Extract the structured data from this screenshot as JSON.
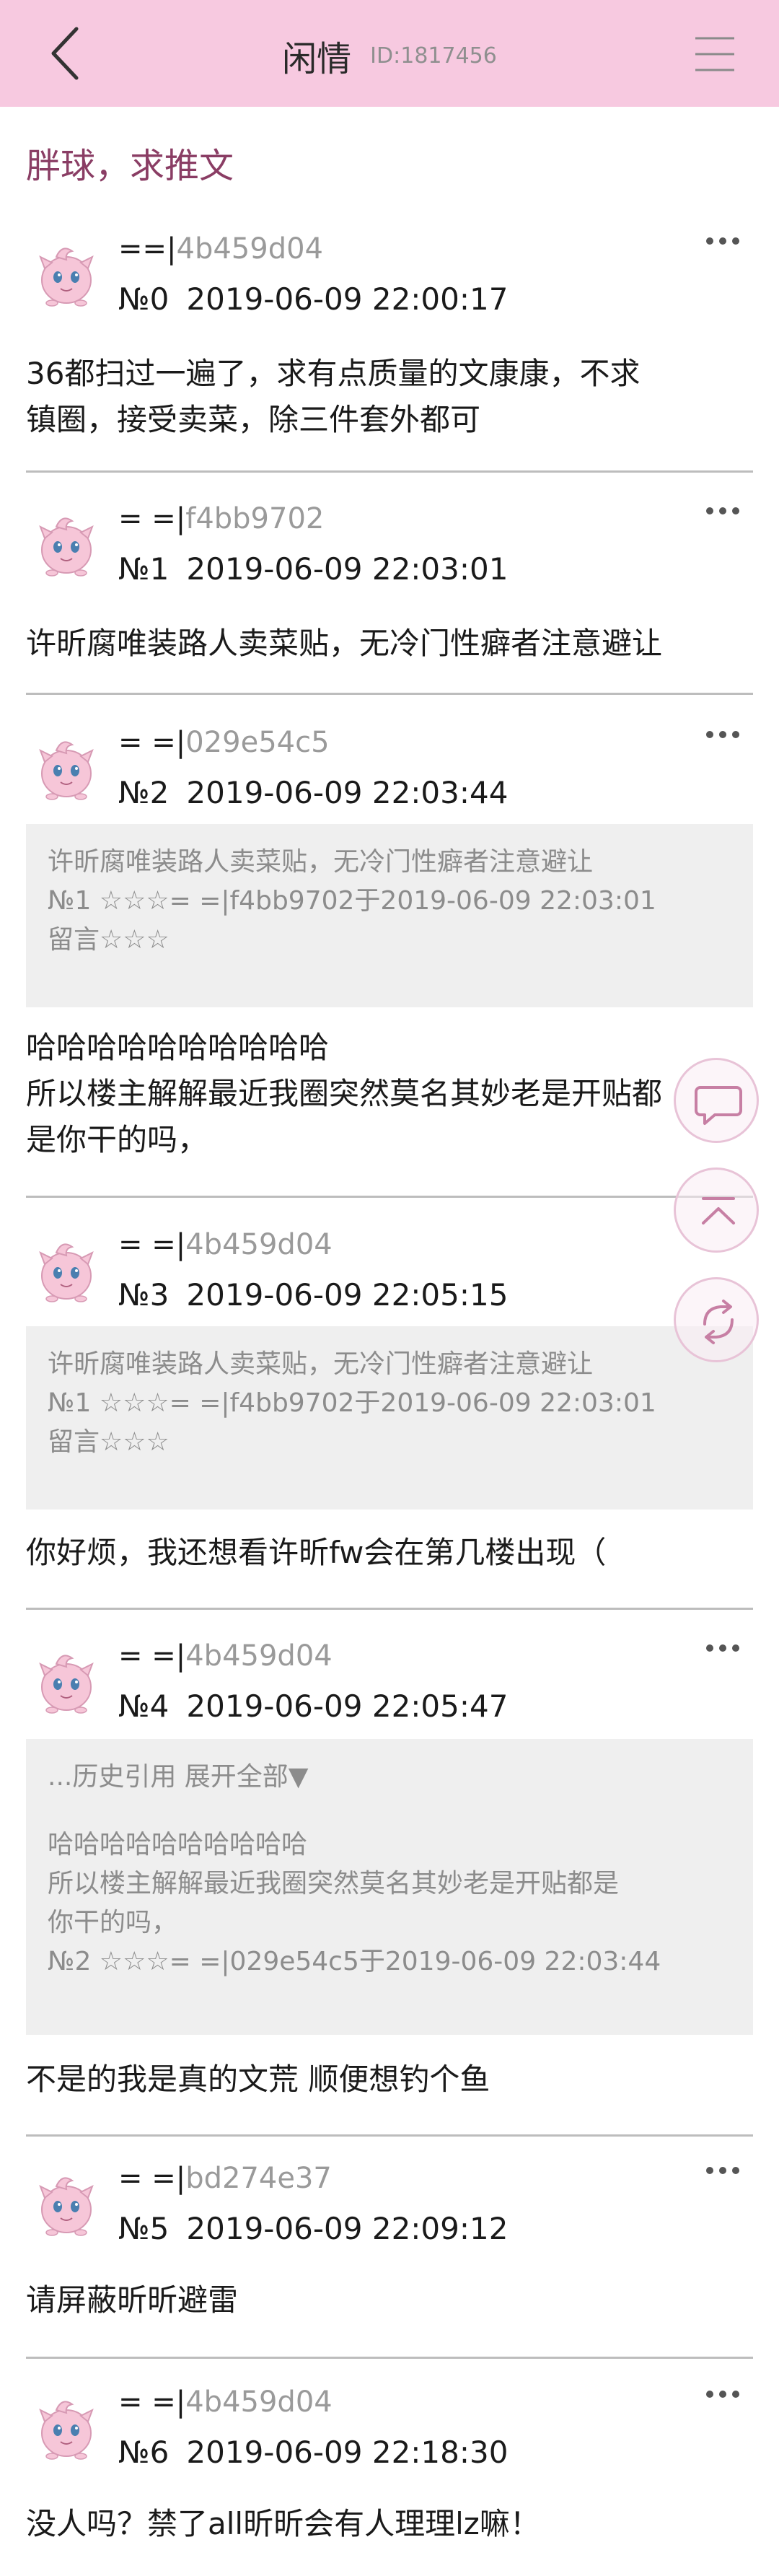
{
  "topbar": {
    "title": "闲情",
    "id_text": "ID:1817456"
  },
  "thread": {
    "title": "胖球，求推文"
  },
  "posts": [
    {
      "user_prefix": "==|",
      "user_hash": "4b459d04",
      "floor": "№0",
      "time": "2019-06-09 22:00:17",
      "text": [
        "36都扫过一遍了，求有点质量的文康康，不求",
        "镇圈，接受卖菜，除三件套外都可"
      ]
    },
    {
      "user_prefix": "= =|",
      "user_hash": "f4bb9702",
      "floor": "№1",
      "time": "2019-06-09 22:03:01",
      "text": [
        "许昕腐唯装路人卖菜贴，无冷门性癖者注意避让"
      ]
    },
    {
      "user_prefix": "= =|",
      "user_hash": "029e54c5",
      "floor": "№2",
      "time": "2019-06-09 22:03:44",
      "quote": [
        "许昕腐唯装路人卖菜贴，无冷门性癖者注意避让",
        "№1 ☆☆☆= =|f4bb9702于2019-06-09 22:03:01",
        "留言☆☆☆"
      ],
      "text": [
        "哈哈哈哈哈哈哈哈哈哈",
        "所以楼主解解最近我圈突然莫名其妙老是开贴都",
        "是你干的吗，"
      ]
    },
    {
      "user_prefix": "= =|",
      "user_hash": "4b459d04",
      "floor": "№3",
      "time": "2019-06-09 22:05:15",
      "quote": [
        "许昕腐唯装路人卖菜贴，无冷门性癖者注意避让",
        "№1 ☆☆☆= =|f4bb9702于2019-06-09 22:03:01",
        "留言☆☆☆"
      ],
      "text": [
        "你好烦，我还想看许昕fw会在第几楼出现（"
      ]
    },
    {
      "user_prefix": "= =|",
      "user_hash": "4b459d04",
      "floor": "№4",
      "time": "2019-06-09 22:05:47",
      "history": "...历史引用 展开全部▼",
      "quote": [
        "哈哈哈哈哈哈哈哈哈哈",
        "所以楼主解解最近我圈突然莫名其妙老是开贴都是",
        "你干的吗，",
        "№2 ☆☆☆= =|029e54c5于2019-06-09 22:03:44"
      ],
      "text": [
        "不是的我是真的文荒 顺便想钓个鱼"
      ]
    },
    {
      "user_prefix": "= =|",
      "user_hash": "bd274e37",
      "floor": "№5",
      "time": "2019-06-09 22:09:12",
      "text": [
        "请屏蔽昕昕避雷"
      ]
    },
    {
      "user_prefix": "= =|",
      "user_hash": "4b459d04",
      "floor": "№6",
      "time": "2019-06-09 22:18:30",
      "text": [
        "没人吗？禁了all昕昕会有人理理lz嘛！"
      ]
    }
  ],
  "fab": {
    "icons": [
      "comment-icon",
      "scroll-top-icon",
      "refresh-icon"
    ]
  },
  "colors": {
    "topbar": "#f7c9e0",
    "thread_title": "#8a3d64",
    "quote_bg": "#efefef",
    "hash": "#9a9a9a"
  }
}
